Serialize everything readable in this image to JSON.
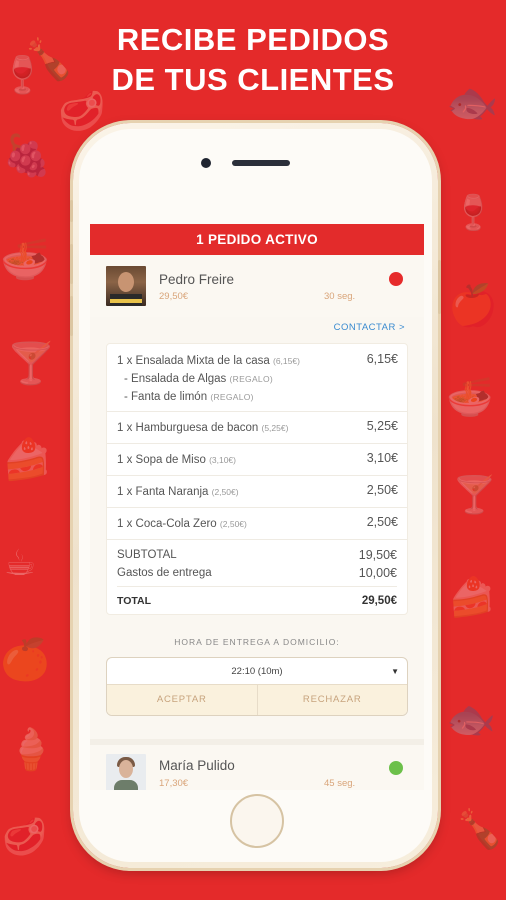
{
  "promo": {
    "line1": "RECIBE PEDIDOS",
    "line2": "DE TUS CLIENTES"
  },
  "colors": {
    "background": "#e42a2a",
    "active_bar": "#e32b2b",
    "status_red": "#e62b2b",
    "status_green": "#6cc04a",
    "link": "#3a8bd0"
  },
  "app": {
    "active_bar": "1 PEDIDO ACTIVO",
    "orders": [
      {
        "customer": "Pedro Freire",
        "total": "29,50€",
        "time": "30 seg.",
        "status": "status-red",
        "contact": "CONTACTAR >",
        "items": [
          {
            "line": "1 x Ensalada Mixta de la casa",
            "unit": "(6,15€)",
            "price": "6,15€",
            "extras": [
              {
                "name": "- Ensalada de Algas",
                "tag": "(REGALO)"
              },
              {
                "name": "- Fanta de limón",
                "tag": "(REGALO)"
              }
            ]
          },
          {
            "line": "1 x Hamburguesa de bacon",
            "unit": "(5,25€)",
            "price": "5,25€"
          },
          {
            "line": "1 x Sopa de Miso",
            "unit": "(3,10€)",
            "price": "3,10€"
          },
          {
            "line": "1 x Fanta Naranja",
            "unit": "(2,50€)",
            "price": "2,50€"
          },
          {
            "line": "1 x Coca-Cola Zero",
            "unit": "(2,50€)",
            "price": "2,50€"
          }
        ],
        "subtotal_label": "SUBTOTAL",
        "subtotal": "19,50€",
        "delivery_fee_label": "Gastos de entrega",
        "delivery_fee": "10,00€",
        "total_label": "TOTAL",
        "grand_total": "29,50€",
        "delivery_time_label": "HORA DE ENTREGA A DOMICILIO:",
        "delivery_time_value": "22:10 (10m)",
        "accept_label": "ACEPTAR",
        "reject_label": "RECHAZAR"
      },
      {
        "customer": "María Pulido",
        "total": "17,30€",
        "time": "45 seg.",
        "status": "status-green"
      }
    ]
  }
}
